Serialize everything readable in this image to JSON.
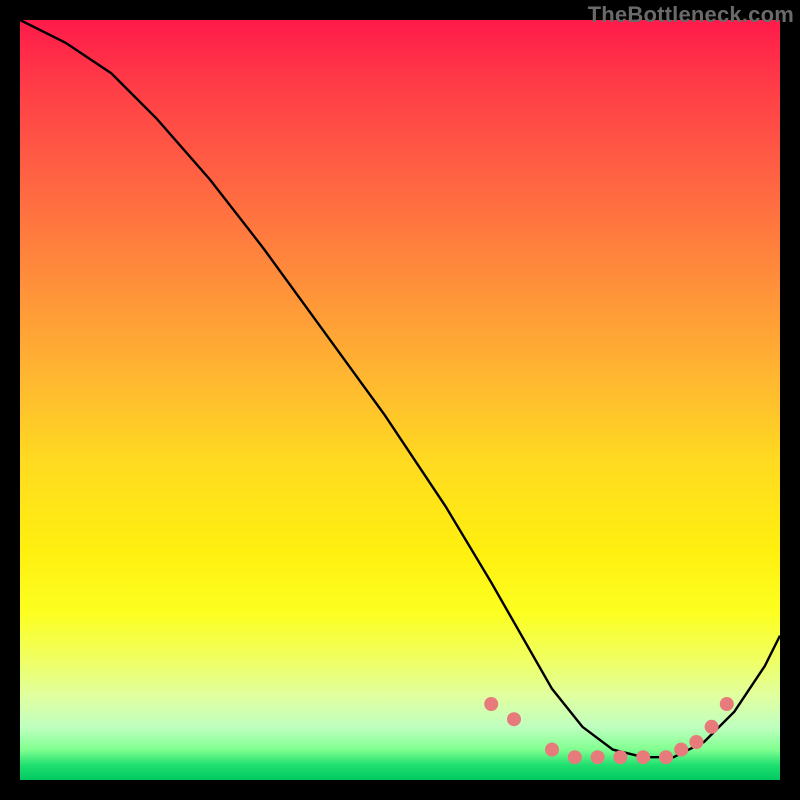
{
  "watermark": "TheBottleneck.com",
  "chart_data": {
    "type": "line",
    "title": "",
    "xlabel": "",
    "ylabel": "",
    "xlim": [
      0,
      100
    ],
    "ylim": [
      0,
      100
    ],
    "series": [
      {
        "name": "curve",
        "x": [
          0,
          6,
          12,
          18,
          25,
          32,
          40,
          48,
          56,
          62,
          66,
          70,
          74,
          78,
          82,
          86,
          90,
          94,
          98,
          100
        ],
        "y": [
          100,
          97,
          93,
          87,
          79,
          70,
          59,
          48,
          36,
          26,
          19,
          12,
          7,
          4,
          3,
          3,
          5,
          9,
          15,
          19
        ]
      }
    ],
    "markers": {
      "name": "dots",
      "color": "#e77b7b",
      "x": [
        62,
        65,
        70,
        73,
        76,
        79,
        82,
        85,
        87,
        89,
        91,
        93
      ],
      "y": [
        10,
        8,
        4,
        3,
        3,
        3,
        3,
        3,
        4,
        5,
        7,
        10
      ]
    },
    "background": "red-yellow-green vertical gradient",
    "grid": false,
    "legend": false
  }
}
